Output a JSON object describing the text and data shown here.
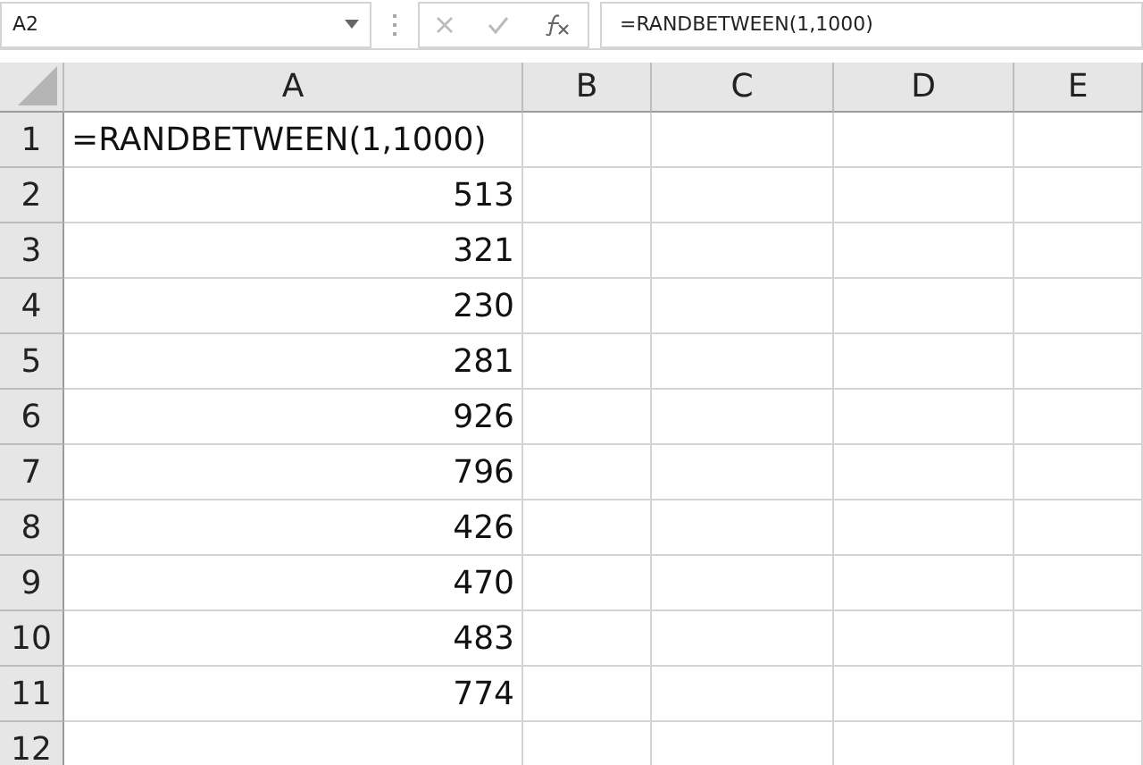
{
  "name_box": {
    "value": "A2"
  },
  "formula_bar": {
    "value": "=RANDBETWEEN(1,1000)"
  },
  "columns": [
    "A",
    "B",
    "C",
    "D",
    "E"
  ],
  "rows": [
    {
      "header": "1",
      "cells": [
        {
          "value": "=RANDBETWEEN(1,1000)",
          "kind": "text"
        }
      ]
    },
    {
      "header": "2",
      "cells": [
        {
          "value": "513",
          "kind": "number"
        }
      ]
    },
    {
      "header": "3",
      "cells": [
        {
          "value": "321",
          "kind": "number"
        }
      ]
    },
    {
      "header": "4",
      "cells": [
        {
          "value": "230",
          "kind": "number"
        }
      ]
    },
    {
      "header": "5",
      "cells": [
        {
          "value": "281",
          "kind": "number"
        }
      ]
    },
    {
      "header": "6",
      "cells": [
        {
          "value": "926",
          "kind": "number"
        }
      ]
    },
    {
      "header": "7",
      "cells": [
        {
          "value": "796",
          "kind": "number"
        }
      ]
    },
    {
      "header": "8",
      "cells": [
        {
          "value": "426",
          "kind": "number"
        }
      ]
    },
    {
      "header": "9",
      "cells": [
        {
          "value": "470",
          "kind": "number"
        }
      ]
    },
    {
      "header": "10",
      "cells": [
        {
          "value": "483",
          "kind": "number"
        }
      ]
    },
    {
      "header": "11",
      "cells": [
        {
          "value": "774",
          "kind": "number"
        }
      ]
    },
    {
      "header": "12",
      "cells": []
    }
  ]
}
